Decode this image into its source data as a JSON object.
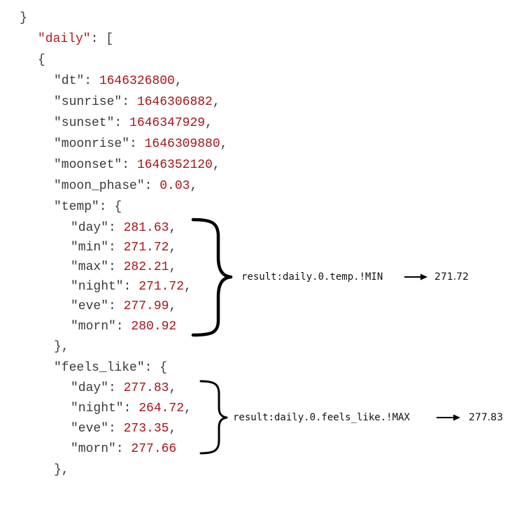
{
  "code": {
    "close_brace": "}",
    "daily_key": "\"daily\"",
    "daily_sep": ": [",
    "open_brace": "{",
    "dt_key": "\"dt\": ",
    "dt_val": "1646326800",
    "dt_comma": ",",
    "sunrise_key": "\"sunrise\": ",
    "sunrise_val": "1646306882",
    "sunrise_comma": ",",
    "sunset_key": "\"sunset\": ",
    "sunset_val": "1646347929",
    "sunset_comma": ",",
    "moonrise_key": "\"moonrise\": ",
    "moonrise_val": "1646309880",
    "moonrise_comma": ",",
    "moonset_key": "\"moonset\": ",
    "moonset_val": "1646352120",
    "moonset_comma": ",",
    "moon_phase_key": "\"moon_phase\": ",
    "moon_phase_val": "0.03",
    "moon_phase_comma": ",",
    "temp_key": "\"temp\": {",
    "temp": {
      "day_key": "\"day\": ",
      "day_val": "281.63",
      "day_comma": ",",
      "min_key": "\"min\": ",
      "min_val": "271.72",
      "min_comma": ",",
      "max_key": "\"max\": ",
      "max_val": "282.21",
      "max_comma": ",",
      "night_key": "\"night\": ",
      "night_val": "271.72",
      "night_comma": ",",
      "eve_key": "\"eve\": ",
      "eve_val": "277.99",
      "eve_comma": ",",
      "morn_key": "\"morn\": ",
      "morn_val": "280.92"
    },
    "temp_close": "},",
    "feels_key": "\"feels_like\": {",
    "feels": {
      "day_key": "\"day\": ",
      "day_val": "277.83",
      "day_comma": ",",
      "night_key": "\"night\": ",
      "night_val": "264.72",
      "night_comma": ",",
      "eve_key": "\"eve\": ",
      "eve_val": "273.35",
      "eve_comma": ",",
      "morn_key": "\"morn\": ",
      "morn_val": "277.66"
    },
    "feels_close": "},"
  },
  "annotations": {
    "temp_query": "result:daily.0.temp.!MIN",
    "temp_result": "271.72",
    "feels_query": "result:daily.0.feels_like.!MAX",
    "feels_result": "277.83"
  }
}
